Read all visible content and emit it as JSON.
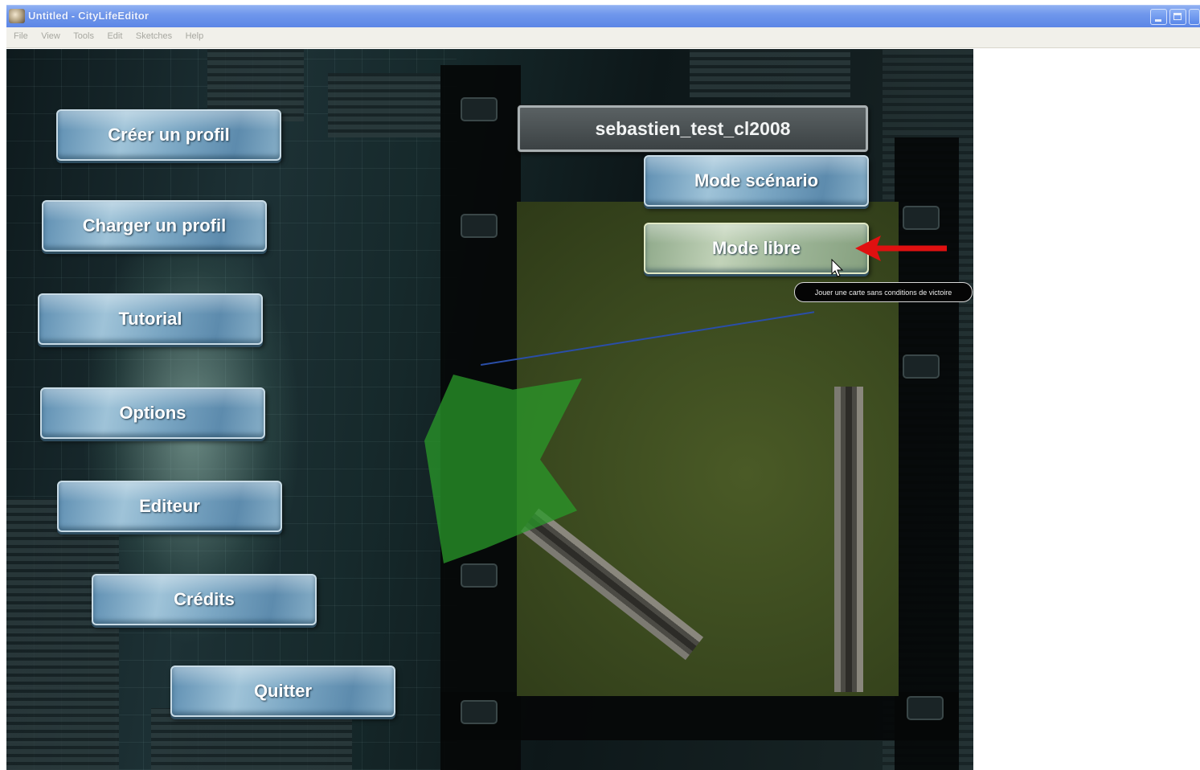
{
  "window": {
    "title": "Untitled - CityLifeEditor",
    "menu": [
      "File",
      "View",
      "Tools",
      "Edit",
      "Sketches",
      "Help"
    ],
    "icons": [
      "app-icon",
      "minimize-icon",
      "maximize-icon",
      "close-icon"
    ]
  },
  "game": {
    "left_menu": [
      "Créer un profil",
      "Charger un profil",
      "Tutorial",
      "Options",
      "Editeur",
      "Crédits",
      "Quitter"
    ],
    "profile_name": "sebastien_test_cl2008",
    "mode_scenario": "Mode scénario",
    "mode_libre": "Mode libre",
    "tooltip": "Jouer une carte sans conditions de victoire",
    "colors": {
      "button_blue": "#7aa6c3",
      "button_highlight": "#c2d3b9",
      "arrow_red": "#e01010",
      "titlebar_blue": "#6f97ec"
    }
  }
}
